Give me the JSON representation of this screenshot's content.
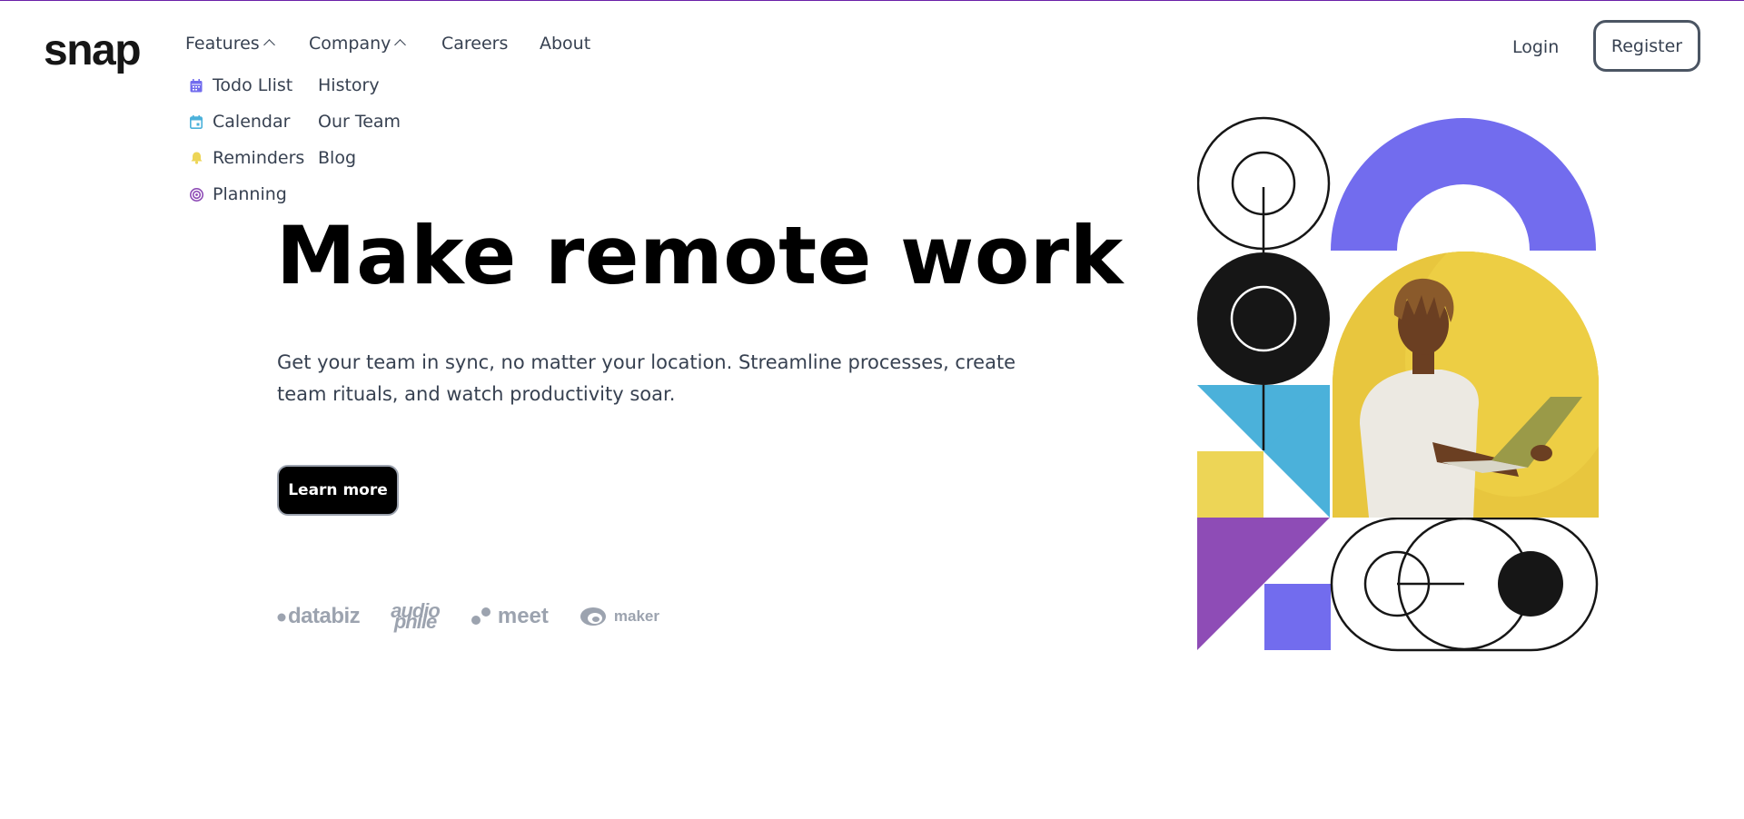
{
  "brand": {
    "logo_text": "snap"
  },
  "nav": {
    "features": {
      "label": "Features"
    },
    "company": {
      "label": "Company"
    },
    "careers": {
      "label": "Careers"
    },
    "about": {
      "label": "About"
    }
  },
  "features_menu": [
    {
      "label": "Todo Llist",
      "icon": "calendar-grid-icon",
      "color": "#726cee"
    },
    {
      "label": "Calendar",
      "icon": "calendar-icon",
      "color": "#4bb1da"
    },
    {
      "label": "Reminders",
      "icon": "bell-icon",
      "color": "#edd556"
    },
    {
      "label": "Planning",
      "icon": "target-icon",
      "color": "#8e4cb6"
    }
  ],
  "company_menu": [
    {
      "label": "History"
    },
    {
      "label": "Our Team"
    },
    {
      "label": "Blog"
    }
  ],
  "auth": {
    "login": "Login",
    "register": "Register"
  },
  "hero": {
    "title": "Make remote work",
    "text": "Get your team in sync, no matter your location. Streamline processes, create team rituals, and watch productivity soar.",
    "cta": "Learn more"
  },
  "clients": {
    "databiz": "databiz",
    "audiophile_top": "audio",
    "audiophile_bottom": "phile",
    "meet": "meet",
    "maker": "maker"
  },
  "colors": {
    "purple": "#726cee",
    "blue": "#4bb1da",
    "yellow": "#edd556",
    "violet": "#8e4cb6",
    "photo_bg": "#e8c63e"
  }
}
